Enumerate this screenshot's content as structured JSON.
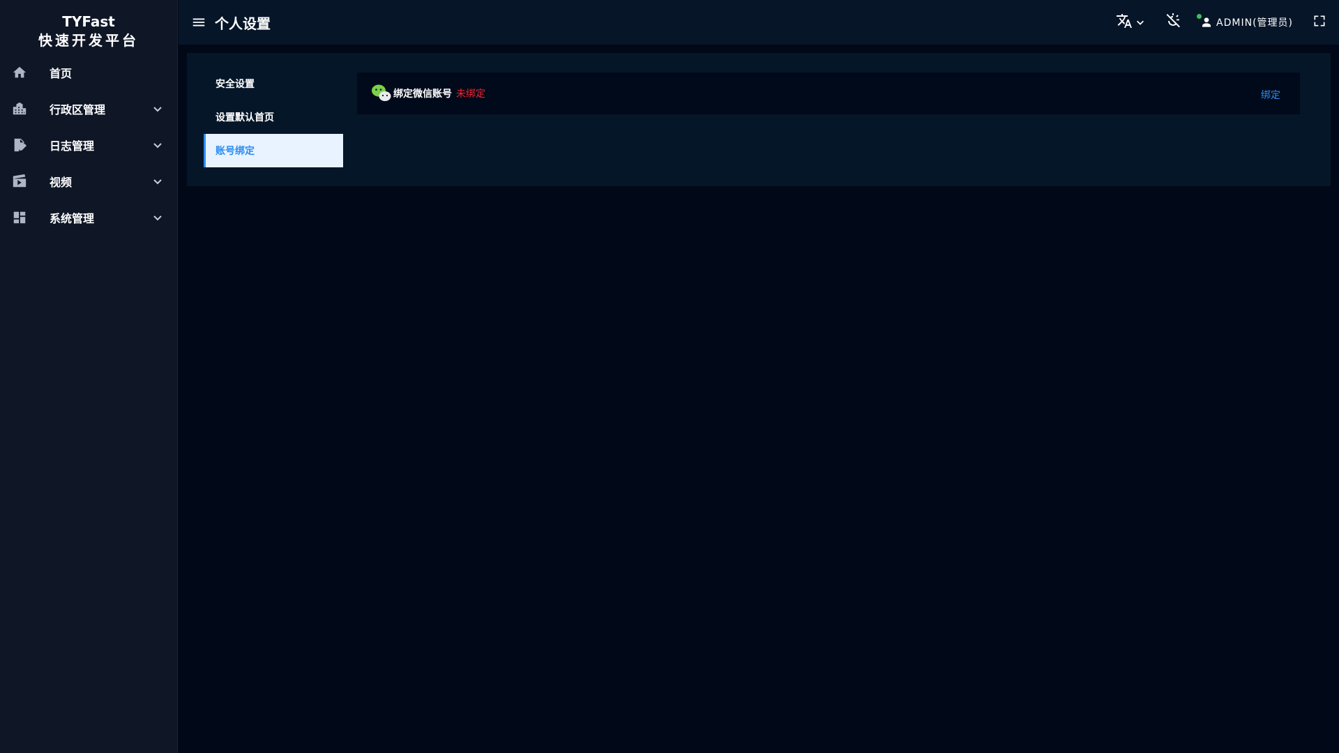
{
  "brand": {
    "name": "TYFast",
    "subtitle": "快速开发平台"
  },
  "sidebar": {
    "items": [
      {
        "label": "首页",
        "icon": "home-icon",
        "expandable": false
      },
      {
        "label": "行政区管理",
        "icon": "building-icon",
        "expandable": true
      },
      {
        "label": "日志管理",
        "icon": "document-edit-icon",
        "expandable": true
      },
      {
        "label": "视频",
        "icon": "clapperboard-icon",
        "expandable": true
      },
      {
        "label": "系统管理",
        "icon": "dashboard-icon",
        "expandable": true
      }
    ]
  },
  "header": {
    "title": "个人设置",
    "user_label": "ADMIN(管理员)",
    "icons": [
      "menu-icon",
      "translate-icon",
      "theme-icon",
      "user-icon",
      "fullscreen-icon"
    ]
  },
  "settings": {
    "tabs": [
      {
        "label": "安全设置",
        "active": false
      },
      {
        "label": "设置默认首页",
        "active": false
      },
      {
        "label": "账号绑定",
        "active": true
      }
    ]
  },
  "binding": {
    "wechat_title": "绑定微信账号",
    "status": "未绑定",
    "action": "绑定"
  },
  "colors": {
    "accent": "#2d8cf0",
    "status_unbound": "#f5222d",
    "sidebar_bg": "#0f1626",
    "page_bg": "#010817",
    "wechat_green": "#7bd14a",
    "online_dot": "#3fbf5c"
  }
}
